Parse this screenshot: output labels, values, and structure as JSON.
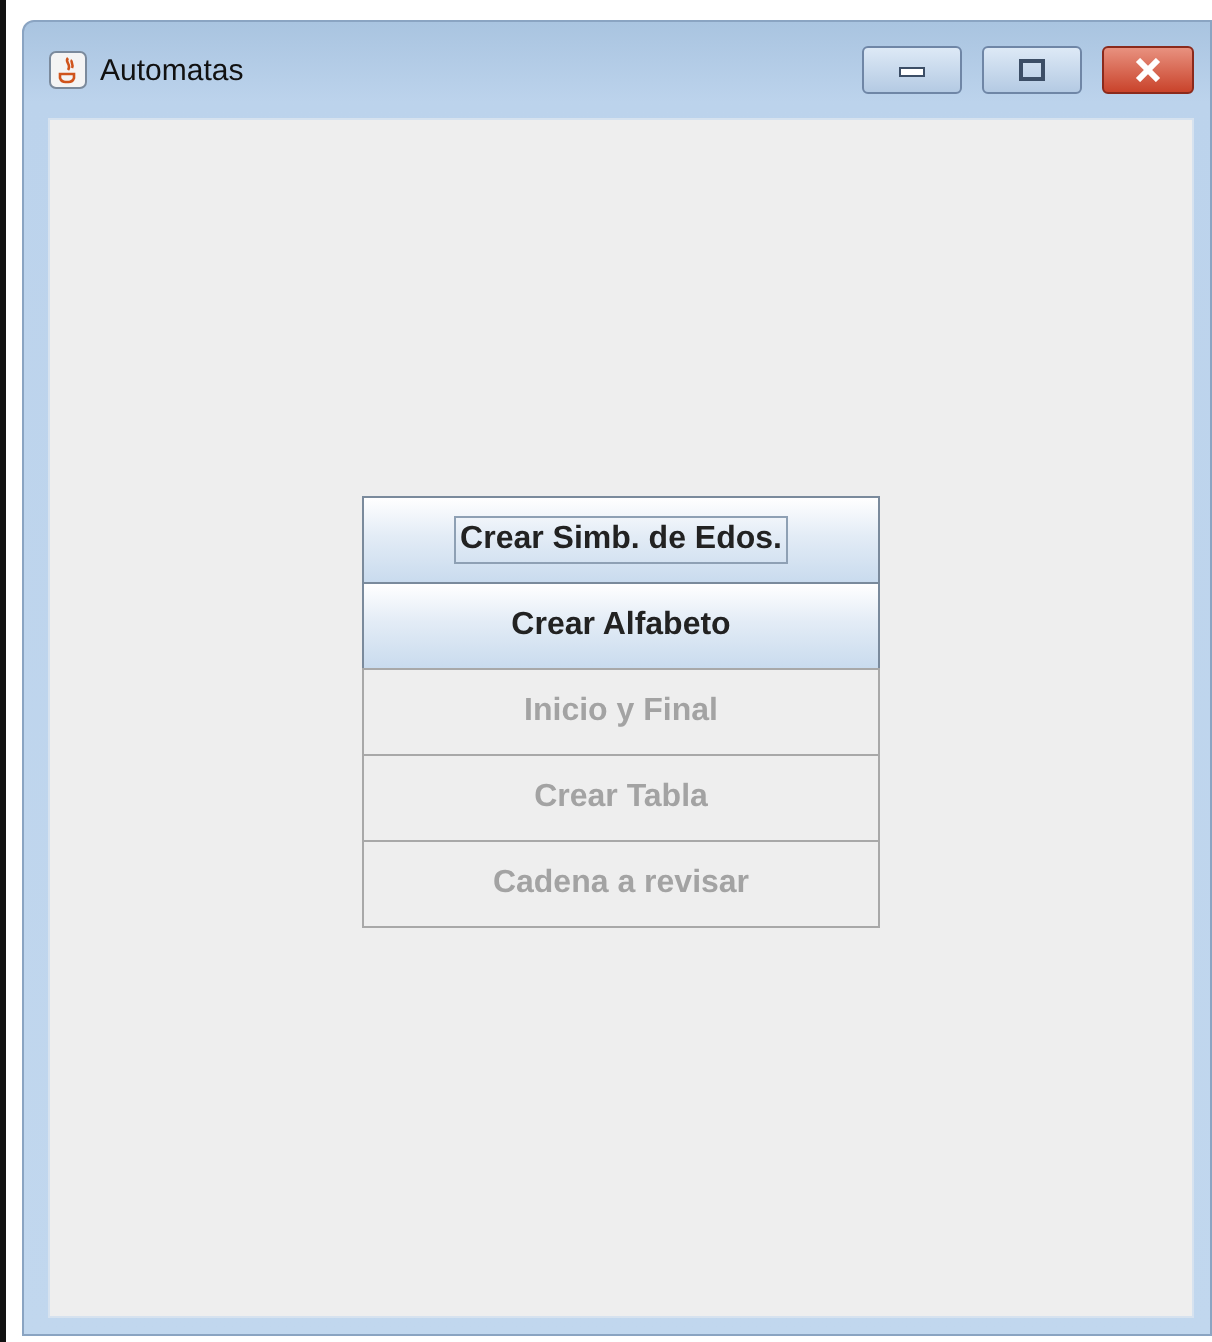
{
  "window": {
    "title": "Automatas"
  },
  "buttons": [
    {
      "label": "Crear Simb. de Edos.",
      "disabled": false,
      "focused": true
    },
    {
      "label": "Crear Alfabeto",
      "disabled": false,
      "focused": false
    },
    {
      "label": "Inicio y Final",
      "disabled": true,
      "focused": false
    },
    {
      "label": "Crear Tabla",
      "disabled": true,
      "focused": false
    },
    {
      "label": "Cadena a revisar",
      "disabled": true,
      "focused": false
    }
  ]
}
